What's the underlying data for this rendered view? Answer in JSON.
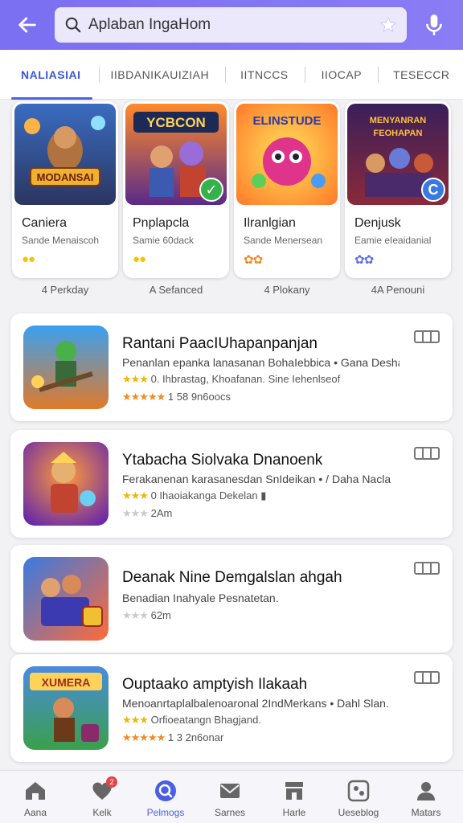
{
  "colors": {
    "accent": "#7b6ff2",
    "tab_active": "#3a56d8",
    "star_gold": "#f5b400",
    "star_orange": "#f08a24",
    "star_blue": "#5a6ee8",
    "star_gray": "#c9c9cf"
  },
  "header": {
    "back_icon": "arrow-left-icon",
    "search_value": "Aplaban IngaHom",
    "search_icon": "search-icon",
    "clear_icon": "star-clear-icon",
    "mic_icon": "microphone-icon"
  },
  "tabs": [
    {
      "label": "NALIASIAI",
      "active": true
    },
    {
      "label": "IIBDANIKAUIZIAH",
      "active": false
    },
    {
      "label": "IITNCCS",
      "active": false
    },
    {
      "label": "IIOCAP",
      "active": false
    },
    {
      "label": "TESECCR",
      "active": false
    }
  ],
  "featured": [
    {
      "name": "Caniera",
      "subtitle": "Sande Menaiscoh",
      "stars": "●●",
      "status": "4 Perkday",
      "art_title": "MODANSAI",
      "badge": ""
    },
    {
      "name": "Pnplapcla",
      "subtitle": "Samie 60dack",
      "stars": "●●",
      "status": "A Sefanced",
      "art_title": "YCBCON",
      "badge": "✓"
    },
    {
      "name": "Ilranlgian",
      "subtitle": "Sande Menersean",
      "stars": "✿✿",
      "status": "4 Plokany",
      "art_title": "ELINSTUDE",
      "badge": ""
    },
    {
      "name": "Denjusk",
      "subtitle": "Eamie eIeaidanial",
      "stars": "✿✿",
      "status": "4A Penouni",
      "art_title": "MENYANRAN FEOHAPAN",
      "badge": "C"
    }
  ],
  "list": [
    {
      "title": "Rantani PaacIUhapanpanjan",
      "desc": "Penanlan epanka lanasanan BohaIebbica • Gana Desha",
      "meta": [
        {
          "stars": "★★★",
          "text": "0. Ihbrastag, Khoafanan. Sine Iehenlseof"
        },
        {
          "stars": "★★★★★",
          "text": "1 58 9n6oocs"
        }
      ]
    },
    {
      "title": "Ytabacha Siolvaka Dnanoenk",
      "desc": "Ferakanenan karasanesdan SnIdeikan • / Daha Nacla",
      "meta": [
        {
          "stars": "★★★",
          "text": "0 Ihaoiakanga Dekelan ▮"
        },
        {
          "stars": "★★★",
          "text": "2Am"
        }
      ]
    },
    {
      "title": "Deanak Nine Demgalslan ahgah",
      "desc": "Benadian Inahyale Pesnatetan.",
      "meta": [
        {
          "stars": "★★★",
          "text": "62m"
        }
      ]
    },
    {
      "title": "Ouptaako amptyish Ilakaah",
      "desc": "Menoanrtaplalbalenoaronal 2IndMerkans • Dahl Slan.",
      "meta": [
        {
          "stars": "★★★",
          "text": "Orfioeatangn Bhagjand."
        },
        {
          "stars": "★★★★★",
          "text": "1 3 2n6onar"
        }
      ]
    }
  ],
  "nav": [
    {
      "label": "Aana",
      "icon": "home-icon",
      "active": false
    },
    {
      "label": "Kelk",
      "icon": "heart-icon",
      "active": false,
      "badge": "2"
    },
    {
      "label": "Pelmogs",
      "icon": "search-icon",
      "active": true
    },
    {
      "label": "Sarnes",
      "icon": "mail-icon",
      "active": false
    },
    {
      "label": "Harle",
      "icon": "store-icon",
      "active": false
    },
    {
      "label": "Ueseblog",
      "icon": "gamepad-icon",
      "active": false
    },
    {
      "label": "Matars",
      "icon": "profile-icon",
      "active": false
    }
  ]
}
